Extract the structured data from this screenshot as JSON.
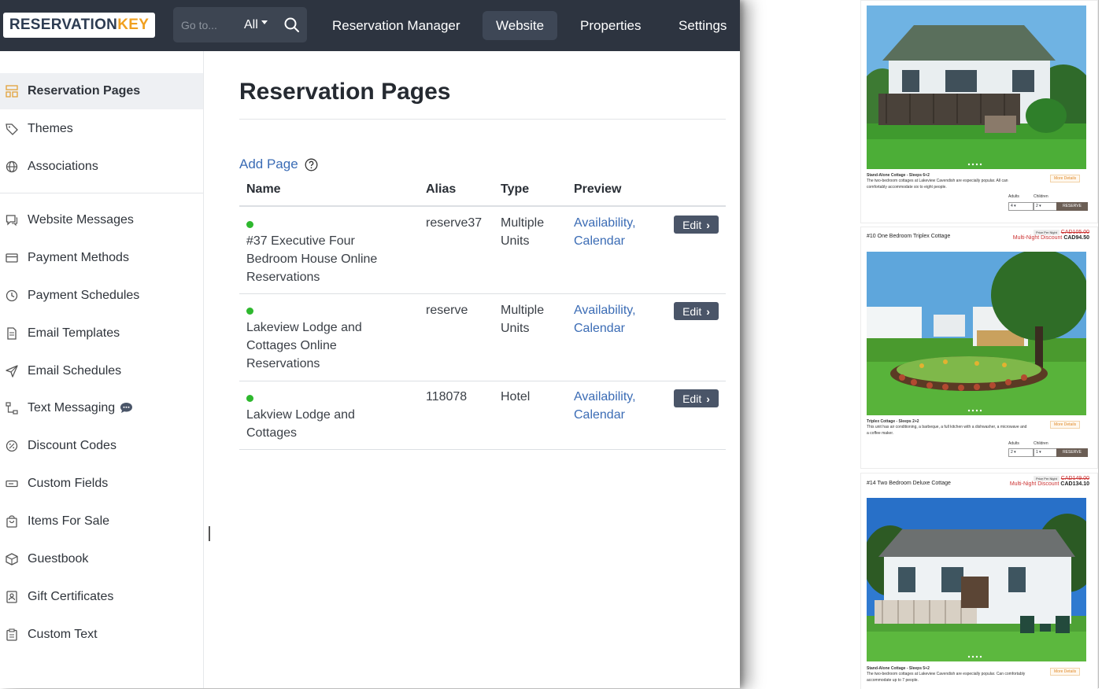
{
  "brand": {
    "part1": "RESERVATION",
    "part2": "KEY"
  },
  "search": {
    "placeholder": "Go to...",
    "scope": "All"
  },
  "nav": [
    {
      "label": "Reservation Manager"
    },
    {
      "label": "Website"
    },
    {
      "label": "Properties"
    },
    {
      "label": "Settings"
    }
  ],
  "sidebar": {
    "items": [
      {
        "label": "Reservation Pages",
        "icon": "layout-icon"
      },
      {
        "label": "Themes",
        "icon": "tag-icon"
      },
      {
        "label": "Associations",
        "icon": "globe-icon"
      },
      {
        "label": "Website Messages",
        "icon": "message-icon"
      },
      {
        "label": "Payment Methods",
        "icon": "card-icon"
      },
      {
        "label": "Payment Schedules",
        "icon": "clock-icon"
      },
      {
        "label": "Email Templates",
        "icon": "document-icon"
      },
      {
        "label": "Email Schedules",
        "icon": "send-icon"
      },
      {
        "label": "Text Messaging",
        "icon": "flow-icon"
      },
      {
        "label": "Discount Codes",
        "icon": "discount-icon"
      },
      {
        "label": "Custom Fields",
        "icon": "field-icon"
      },
      {
        "label": "Items For Sale",
        "icon": "bag-icon"
      },
      {
        "label": "Guestbook",
        "icon": "box-icon"
      },
      {
        "label": "Gift Certificates",
        "icon": "badge-icon"
      },
      {
        "label": "Custom Text",
        "icon": "clipboard-icon"
      }
    ]
  },
  "main": {
    "title": "Reservation Pages",
    "add_page": "Add Page",
    "columns": {
      "name": "Name",
      "alias": "Alias",
      "type": "Type",
      "preview": "Preview"
    },
    "rows": [
      {
        "name": [
          "#37 Executive Four",
          "Bedroom House Online",
          "Reservations"
        ],
        "alias": "reserve37",
        "type": [
          "Multiple",
          "Units"
        ],
        "preview": [
          "Availability,",
          "Calendar"
        ],
        "action": "Edit"
      },
      {
        "name": [
          "Lakeview Lodge and",
          "Cottages Online",
          "Reservations"
        ],
        "alias": "reserve",
        "type": [
          "Multiple",
          "Units"
        ],
        "preview": [
          "Availability,",
          "Calendar"
        ],
        "action": "Edit"
      },
      {
        "name": [
          "Lakview Lodge and",
          "Cottages"
        ],
        "alias": "118078",
        "type": [
          "Hotel"
        ],
        "preview": [
          "Availability,",
          "Calendar"
        ],
        "action": "Edit"
      }
    ]
  },
  "preview": {
    "cards": [
      {
        "category": "Stand-Alone Cottage - Sleeps 6+2",
        "desc1": "The two-bedroom cottages at Lakeview Cavendish are especially popular. All can",
        "desc2": "comfortably accommodate six to eight people.",
        "more": "More Details",
        "adults_label": "Adults",
        "children_label": "Children",
        "adults": "4",
        "children": "2",
        "reserve": "RESERVE"
      },
      {
        "title": "#10 One Bedroom Triplex Cottage",
        "price_label": "Price Per Night",
        "old_price": "CAD105.00",
        "discount": "Multi-Night Discount",
        "new_price": "CAD94.50",
        "category": "Triplex Cottage - Sleeps 2+2",
        "desc1": "This unit has air conditioning, a barbeque, a full kitchen with a dishwasher, a microwave and",
        "desc2": "a coffee maker.",
        "more": "More Details",
        "adults_label": "Adults",
        "children_label": "Children",
        "adults": "2",
        "children": "1",
        "reserve": "RESERVE"
      },
      {
        "title": "#14 Two Bedroom Deluxe Cottage",
        "price_label": "Price Per Night",
        "old_price": "CAD149.00",
        "discount": "Multi-Night Discount",
        "new_price": "CAD134.10",
        "category": "Stand-Alone Cottage - Sleeps 5+2",
        "desc1": "The two-bedroom cottages at Lakeview Cavendish are especially popular. Can comfortably",
        "desc2": "accommodate up to 7 people.",
        "more": "More Details"
      }
    ]
  },
  "colors": {
    "topbar": "#2d3440",
    "accent": "#f0a020",
    "link": "#3b6cb5",
    "status": "#2eb82e",
    "button": "#4a5568"
  }
}
